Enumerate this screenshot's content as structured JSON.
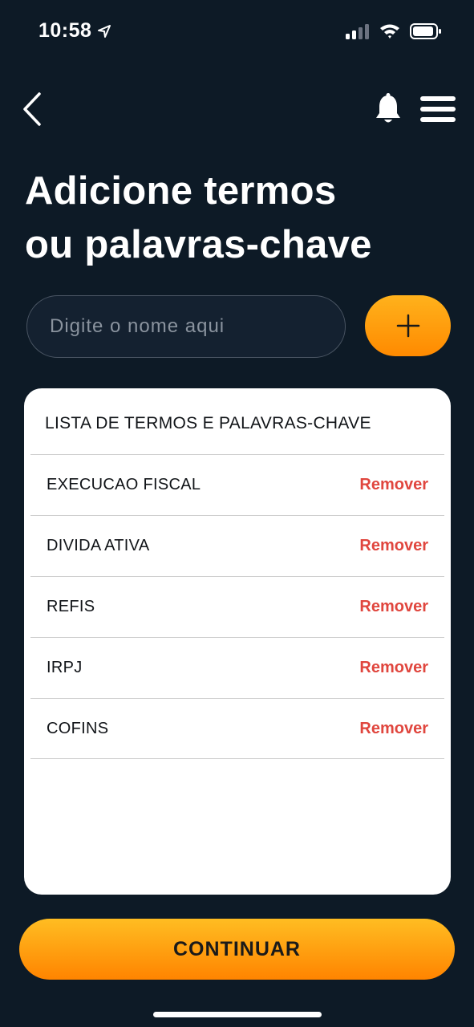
{
  "status_bar": {
    "time": "10:58",
    "location_icon": "location-arrow-icon",
    "signal_icon": "cellular-signal-icon",
    "wifi_icon": "wifi-icon",
    "battery_icon": "battery-icon"
  },
  "nav": {
    "back_icon": "chevron-left-icon",
    "bell_icon": "bell-icon",
    "menu_icon": "hamburger-menu-icon"
  },
  "title": {
    "line1": "Adicione termos",
    "line2": "ou palavras-chave"
  },
  "search": {
    "placeholder": "Digite o nome aqui",
    "value": ""
  },
  "add_button": {
    "icon": "plus-icon"
  },
  "list": {
    "header": "LISTA DE TERMOS E PALAVRAS-CHAVE",
    "items": [
      {
        "label": "EXECUCAO FISCAL",
        "action": "Remover"
      },
      {
        "label": "DIVIDA ATIVA",
        "action": "Remover"
      },
      {
        "label": "REFIS",
        "action": "Remover"
      },
      {
        "label": "IRPJ",
        "action": "Remover"
      },
      {
        "label": "COFINS",
        "action": "Remover"
      }
    ]
  },
  "continue_button": {
    "label": "CONTINUAR"
  },
  "colors": {
    "background": "#0d1a26",
    "accent": "#ff9a0a",
    "remove": "#e0463e",
    "card": "#ffffff"
  }
}
